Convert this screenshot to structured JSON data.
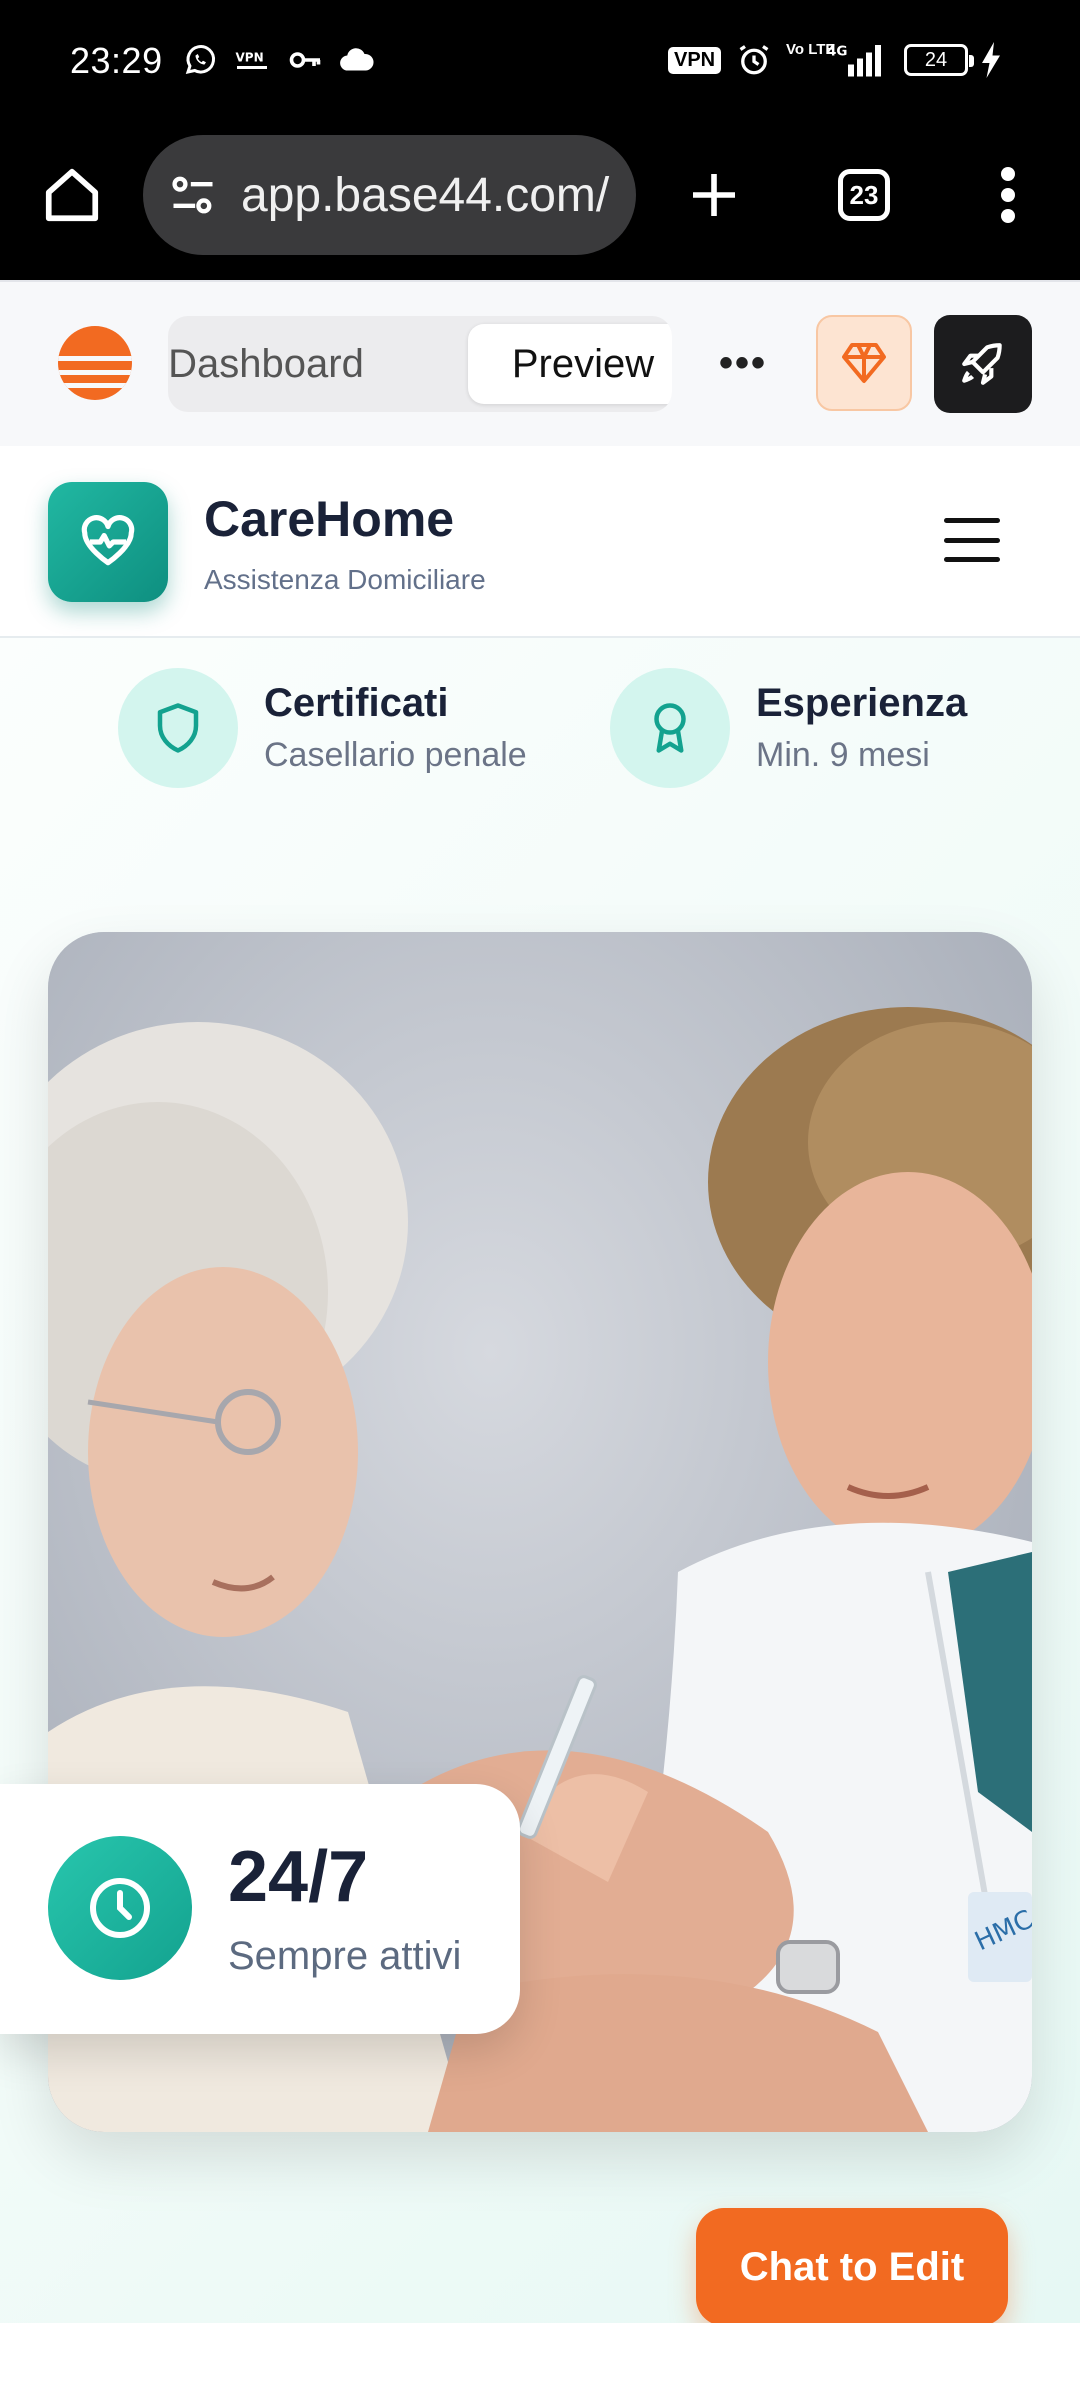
{
  "status_bar": {
    "time": "23:29",
    "vpn_badge": "VPN",
    "network": "4G",
    "volte": "Vo LTE",
    "battery": "24"
  },
  "browser": {
    "url": "app.base44.com/",
    "tab_count": "23"
  },
  "base44_toolbar": {
    "tabs": [
      {
        "label": "Dashboard",
        "active": false
      },
      {
        "label": "Preview",
        "active": true
      }
    ],
    "more_label": "•••",
    "accent_color": "#f26a21"
  },
  "app": {
    "title": "CareHome",
    "subtitle": "Assistenza Domiciliare",
    "brand_color": "#13a28f"
  },
  "features": [
    {
      "icon": "shield-icon",
      "title": "Certificati",
      "subtitle": "Casellario penale"
    },
    {
      "icon": "award-icon",
      "title": "Esperienza",
      "subtitle": "Min. 9 mesi"
    }
  ],
  "hero_image": {
    "alt": "Infermiera che assiste una signora anziana"
  },
  "stat": {
    "value": "24/7",
    "label": "Sempre attivi"
  },
  "chat_button": {
    "label": "Chat to Edit"
  }
}
